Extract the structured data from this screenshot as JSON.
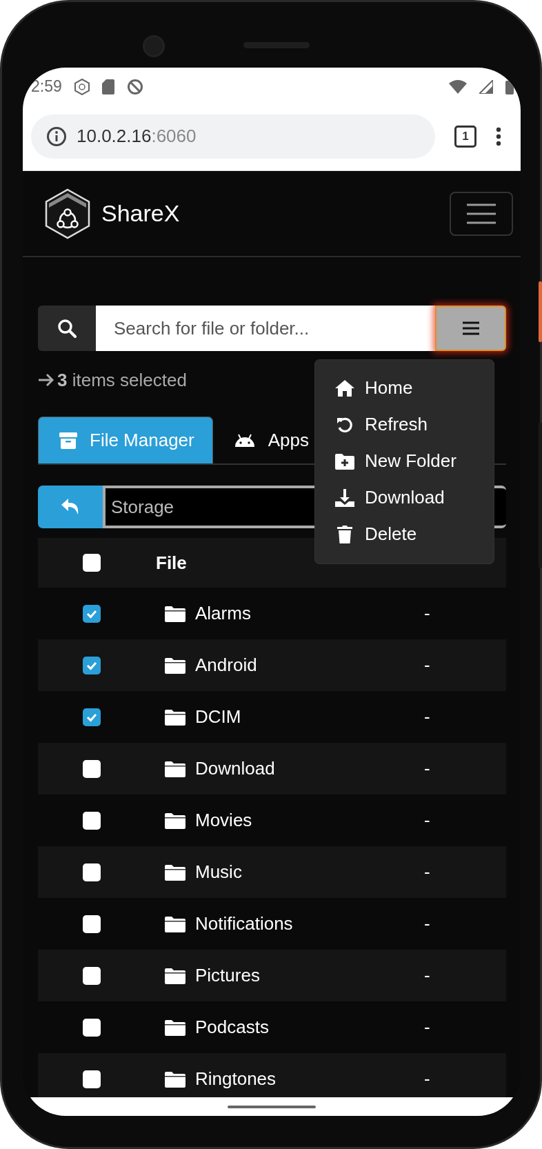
{
  "status_bar": {
    "time": "2:59"
  },
  "browser": {
    "url_host": "10.0.2.16",
    "url_port": ":6060",
    "tab_count": "1"
  },
  "navbar": {
    "brand": "ShareX"
  },
  "search": {
    "placeholder": "Search for file or folder...",
    "menu_open": true
  },
  "selection": {
    "text": "**3** items selected"
  },
  "tabs": [
    {
      "label": "File Manager",
      "kind": "archive",
      "selected": true
    },
    {
      "label": "Apps",
      "kind": "android",
      "selected": false
    }
  ],
  "path": {
    "value": "Storage"
  },
  "table": {
    "columns": [
      "File"
    ],
    "header_checked": false,
    "rows": [
      {
        "name": "Alarms",
        "size": "-",
        "checked": true
      },
      {
        "name": "Android",
        "size": "-",
        "checked": true
      },
      {
        "name": "DCIM",
        "size": "-",
        "checked": true
      },
      {
        "name": "Download",
        "size": "-",
        "checked": false
      },
      {
        "name": "Movies",
        "size": "-",
        "checked": false
      },
      {
        "name": "Music",
        "size": "-",
        "checked": false
      },
      {
        "name": "Notifications",
        "size": "-",
        "checked": false
      },
      {
        "name": "Pictures",
        "size": "-",
        "checked": false
      },
      {
        "name": "Podcasts",
        "size": "-",
        "checked": false
      },
      {
        "name": "Ringtones",
        "size": "-",
        "checked": false
      }
    ]
  },
  "menu": {
    "items": [
      {
        "label": "Home",
        "kind": "home"
      },
      {
        "label": "Refresh",
        "kind": "refresh"
      },
      {
        "label": "New Folder",
        "kind": "new-folder"
      },
      {
        "label": "Download",
        "kind": "download"
      },
      {
        "label": "Delete",
        "kind": "delete"
      }
    ]
  }
}
